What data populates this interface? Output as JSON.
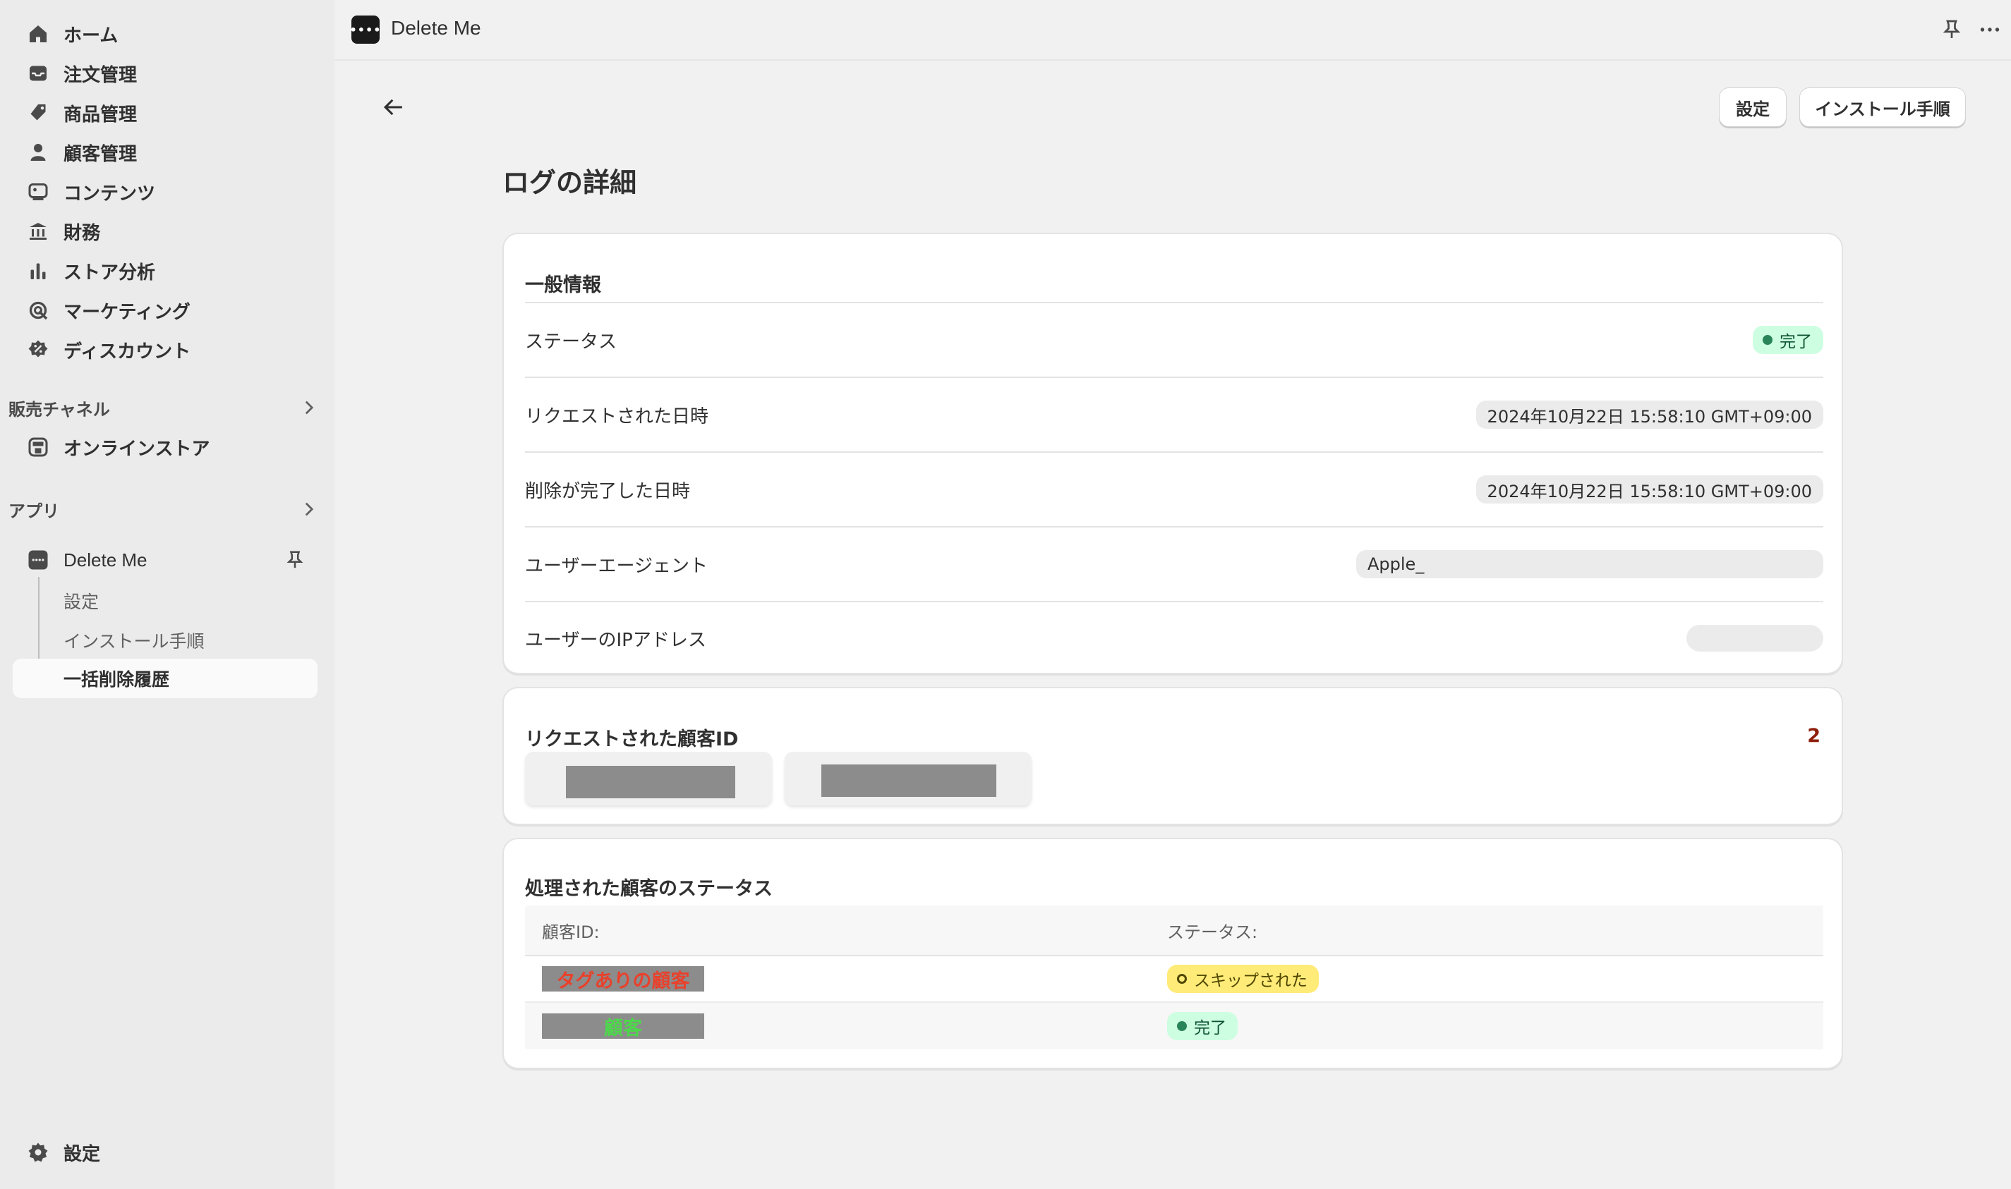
{
  "sidebar": {
    "items": [
      {
        "label": "ホーム",
        "icon": "home-icon"
      },
      {
        "label": "注文管理",
        "icon": "inbox-icon"
      },
      {
        "label": "商品管理",
        "icon": "tag-icon"
      },
      {
        "label": "顧客管理",
        "icon": "person-icon"
      },
      {
        "label": "コンテンツ",
        "icon": "content-icon"
      },
      {
        "label": "財務",
        "icon": "bank-icon"
      },
      {
        "label": "ストア分析",
        "icon": "bar-chart-icon"
      },
      {
        "label": "マーケティング",
        "icon": "target-icon"
      },
      {
        "label": "ディスカウント",
        "icon": "discount-icon"
      }
    ],
    "sales_channels": {
      "heading": "販売チャネル",
      "items": [
        {
          "label": "オンラインストア",
          "icon": "store-icon"
        }
      ]
    },
    "apps": {
      "heading": "アプリ",
      "app": {
        "label": "Delete Me",
        "icon": "app-icon"
      },
      "subitems": [
        "設定",
        "インストール手順",
        "一括削除履歴"
      ]
    },
    "settings_label": "設定"
  },
  "topbar": {
    "app_title": "Delete Me",
    "logo_text": "••••"
  },
  "header": {
    "settings_button": "設定",
    "install_button": "インストール手順"
  },
  "page": {
    "title": "ログの詳細"
  },
  "general": {
    "title": "一般情報",
    "rows": [
      {
        "label": "ステータス",
        "value": "完了"
      },
      {
        "label": "リクエストされた日時",
        "value": "2024年10月22日 15:58:10 GMT+09:00"
      },
      {
        "label": "削除が完了した日時",
        "value": "2024年10月22日 15:58:10 GMT+09:00"
      },
      {
        "label": "ユーザーエージェント",
        "value": "Apple_"
      },
      {
        "label": "ユーザーのIPアドレス",
        "value": ""
      }
    ]
  },
  "requested": {
    "title": "リクエストされた顧客ID",
    "count": "2"
  },
  "processed": {
    "title": "処理された顧客のステータス",
    "columns": [
      "顧客ID:",
      "ステータス:"
    ],
    "rows": [
      {
        "id": "タグありの顧客",
        "id_color": "#e8412c",
        "status": "スキップされた",
        "status_type": "warn"
      },
      {
        "id": "顧客",
        "id_color": "#4cd84a",
        "status": "完了",
        "status_type": "success"
      }
    ]
  },
  "colors": {
    "success_bg": "#cdfee1",
    "warn_bg": "#ffeb78",
    "count_color": "#8e1f0b"
  }
}
